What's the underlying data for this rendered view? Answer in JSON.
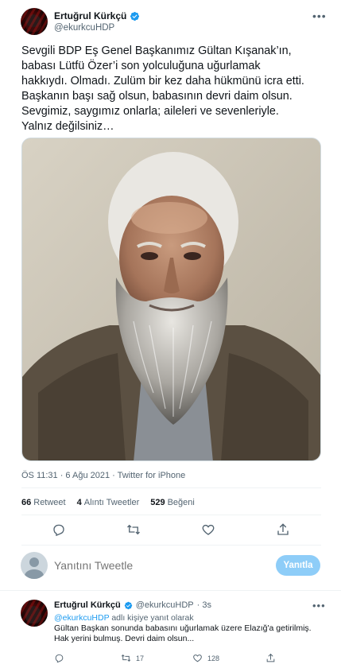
{
  "tweet": {
    "author_name": "Ertuğrul Kürkçü",
    "author_handle": "@ekurkcuHDP",
    "text_lines": [
      "Sevgili BDP Eş Genel Başkanımız Gültan Kışanak’ın,",
      "babası Lütfü Özer’i son yolculuğuna uğurlamak",
      "hakkıydı. Olmadı. Zulüm bir kez daha hükmünü icra etti.",
      "Başkanın başı sağ olsun, babasının devri daim olsun.",
      "Sevgimiz, saygımız onlarla; aileleri ve sevenleriyle.",
      "Yalnız değilsiniz…"
    ],
    "meta": "ÖS 11:31 · 6 Ağu 2021 · Twitter for iPhone",
    "stats": {
      "retweets_count": "66",
      "retweets_label": "Retweet",
      "quotes_count": "4",
      "quotes_label": "Alıntı Tweetler",
      "likes_count": "529",
      "likes_label": "Beğeni"
    },
    "icons": {
      "verified": "verified-badge-icon",
      "more": "more-options-icon",
      "reply": "reply-icon",
      "retweet": "retweet-icon",
      "like": "heart-icon",
      "share": "share-icon"
    }
  },
  "reply_composer": {
    "placeholder": "Yanıtını Tweetle",
    "button_label": "Yanıtla",
    "button_color": "#8ecdf8"
  },
  "reply_tweet": {
    "author_name": "Ertuğrul Kürkçü",
    "author_handle": "@ekurkcuHDP",
    "time": "· 3s",
    "replying_to_handle": "@ekurkcuHDP",
    "replying_to_suffix": "adlı kişiye yanıt olarak",
    "text_lines": [
      "Gültan Başkan sonunda babasını uğurlamak üzere Elazığ'a getirilmiş.",
      "Hak yerini bulmuş. Devri daim olsun..."
    ],
    "retweet_count": "17",
    "like_count": "128"
  },
  "colors": {
    "accent": "#1d9bf0",
    "secondary_text": "#536471",
    "primary_text": "#0f1419"
  }
}
